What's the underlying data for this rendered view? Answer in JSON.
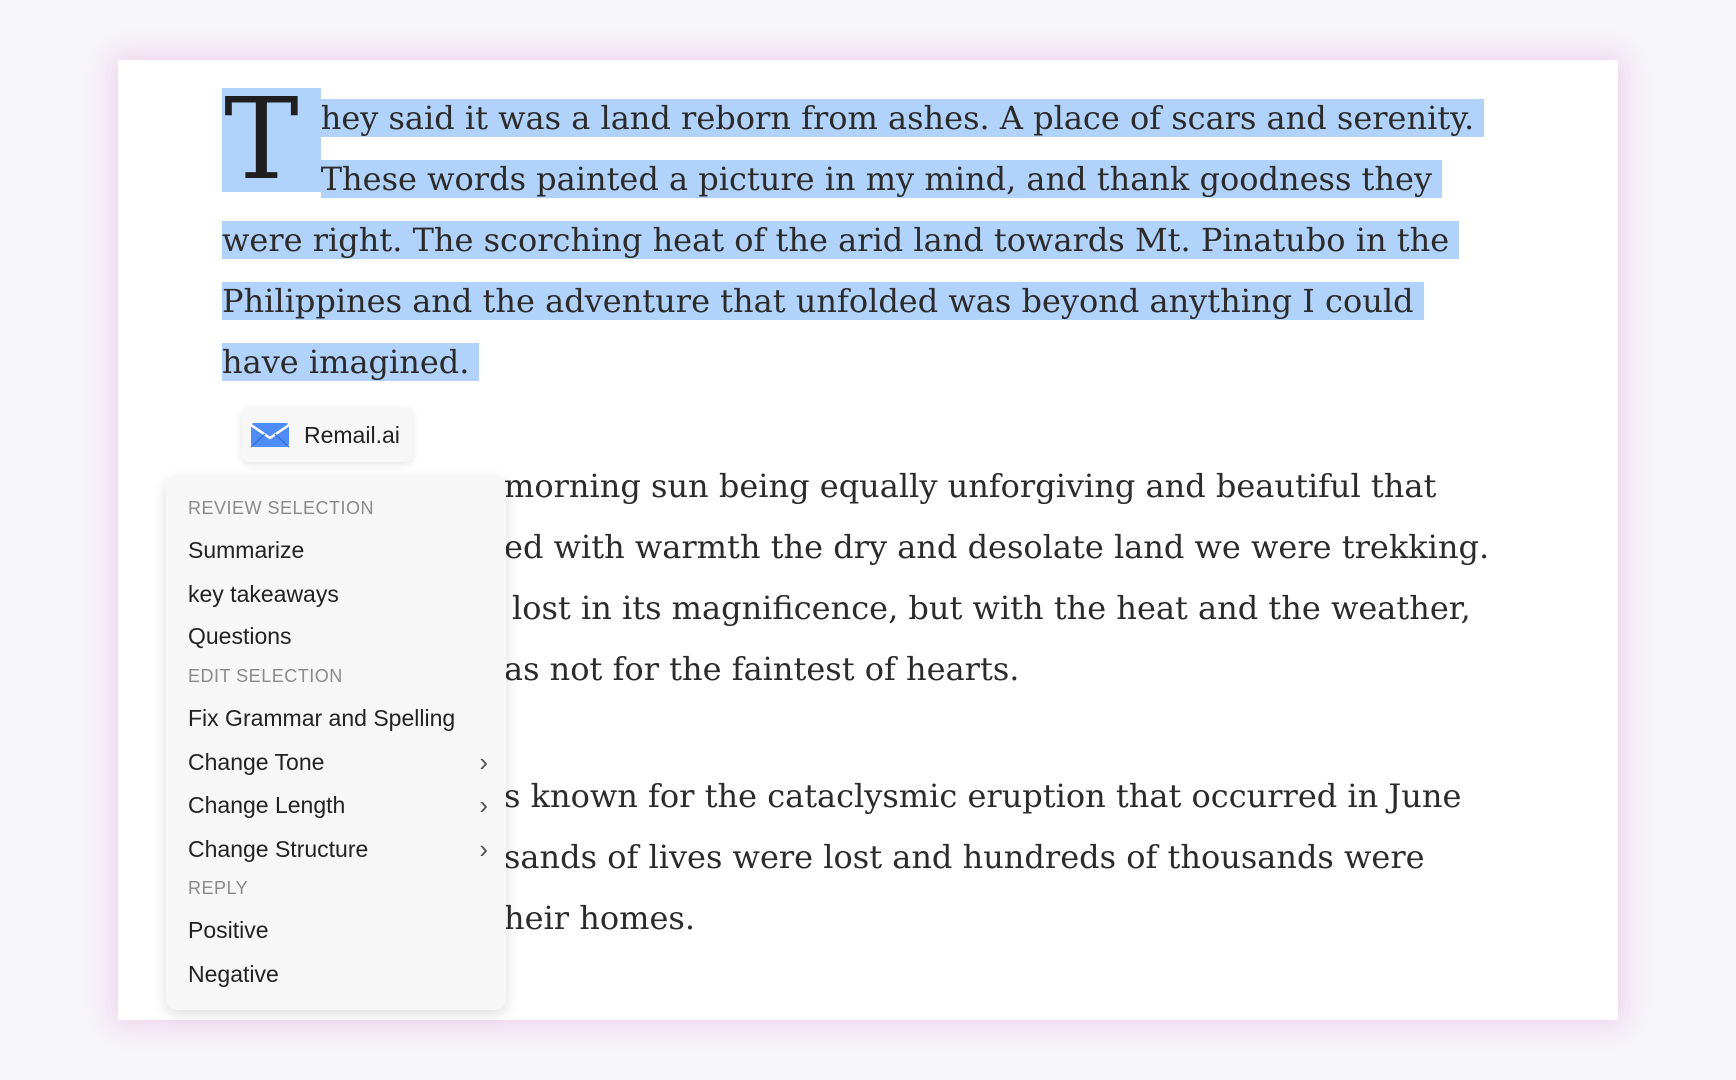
{
  "document": {
    "paragraph1": {
      "dropcap": "T",
      "line1": "hey said it was a land reborn from ashes. A place of scars and serenity.",
      "line2": "These words painted a picture in my mind, and thank goodness they",
      "line3": "were right. The scorching heat of the arid land towards Mt. Pinatubo in the",
      "line4": "Philippines and the adventure that unfolded was beyond anything I could",
      "line5": "have imagined."
    },
    "paragraph2": {
      "line1": "morning sun being equally unforgiving and beautiful that",
      "line2": "ed with warmth the dry and desolate land we were trekking.",
      "line3": "lost in its magnificence, but with the heat and the weather,",
      "line4": "as not for the faintest of hearts."
    },
    "paragraph3": {
      "line1": "s known for the cataclysmic eruption that occurred in June",
      "line2": "sands of lives were lost and hundreds of thousands were",
      "line3": "heir homes."
    }
  },
  "remail": {
    "label": "Remail.ai",
    "icon": "mail-icon",
    "accent": "#4f8cf7"
  },
  "menu": {
    "review_heading": "REVIEW SELECTION",
    "summarize": "Summarize",
    "key_takeaways": "key takeaways",
    "questions": "Questions",
    "edit_heading": "EDIT SELECTION",
    "fix_grammar": "Fix Grammar and Spelling",
    "change_tone": "Change Tone",
    "change_length": "Change Length",
    "change_structure": "Change Structure",
    "reply_heading": "REPLY",
    "positive": "Positive",
    "negative": "Negative",
    "submenu_glyph": "›"
  },
  "colors": {
    "selection": "#b1d3fb",
    "glow": "#e6afe6"
  }
}
